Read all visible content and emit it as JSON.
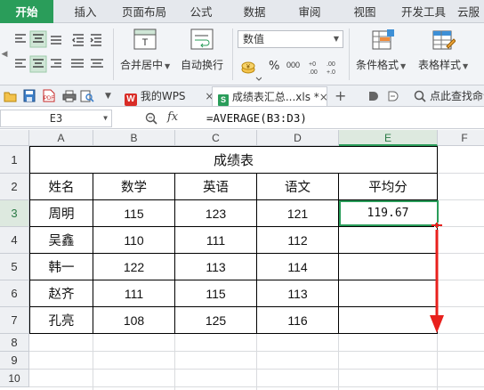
{
  "ribbon_tabs": [
    "开始",
    "插入",
    "页面布局",
    "公式",
    "数据",
    "审阅",
    "视图",
    "开发工具",
    "云服"
  ],
  "ribbon": {
    "merge_label": "合并居中",
    "wrap_label": "自动换行",
    "number_format": "数值",
    "percent": "%",
    "thousands": "000",
    "cond_format_label": "条件格式",
    "table_style_label": "表格样式"
  },
  "quickbar": {
    "wps_tab": "我的WPS",
    "doc_tab": "成绩表汇总...xls",
    "doc_tab_mark": "*",
    "find_cmd": "点此查找命令",
    "add": "+",
    "close": "×"
  },
  "formula_bar": {
    "cell_ref": "E3",
    "fx": "fx",
    "formula": "=AVERAGE(B3:D3)"
  },
  "sheet": {
    "columns": [
      "A",
      "B",
      "C",
      "D",
      "E",
      "F"
    ],
    "rows": [
      "1",
      "2",
      "3",
      "4",
      "5",
      "6",
      "7",
      "8",
      "9",
      "10"
    ],
    "title": "成绩表",
    "headers": [
      "姓名",
      "数学",
      "英语",
      "语文",
      "平均分"
    ],
    "data": [
      [
        "周明",
        "115",
        "123",
        "121",
        "119.67"
      ],
      [
        "吴鑫",
        "110",
        "111",
        "112",
        ""
      ],
      [
        "韩一",
        "122",
        "113",
        "114",
        ""
      ],
      [
        "赵齐",
        "111",
        "115",
        "113",
        ""
      ],
      [
        "孔亮",
        "108",
        "125",
        "116",
        ""
      ]
    ]
  },
  "colors": {
    "accent": "#2a9d5a",
    "arrow": "#e8201d"
  }
}
